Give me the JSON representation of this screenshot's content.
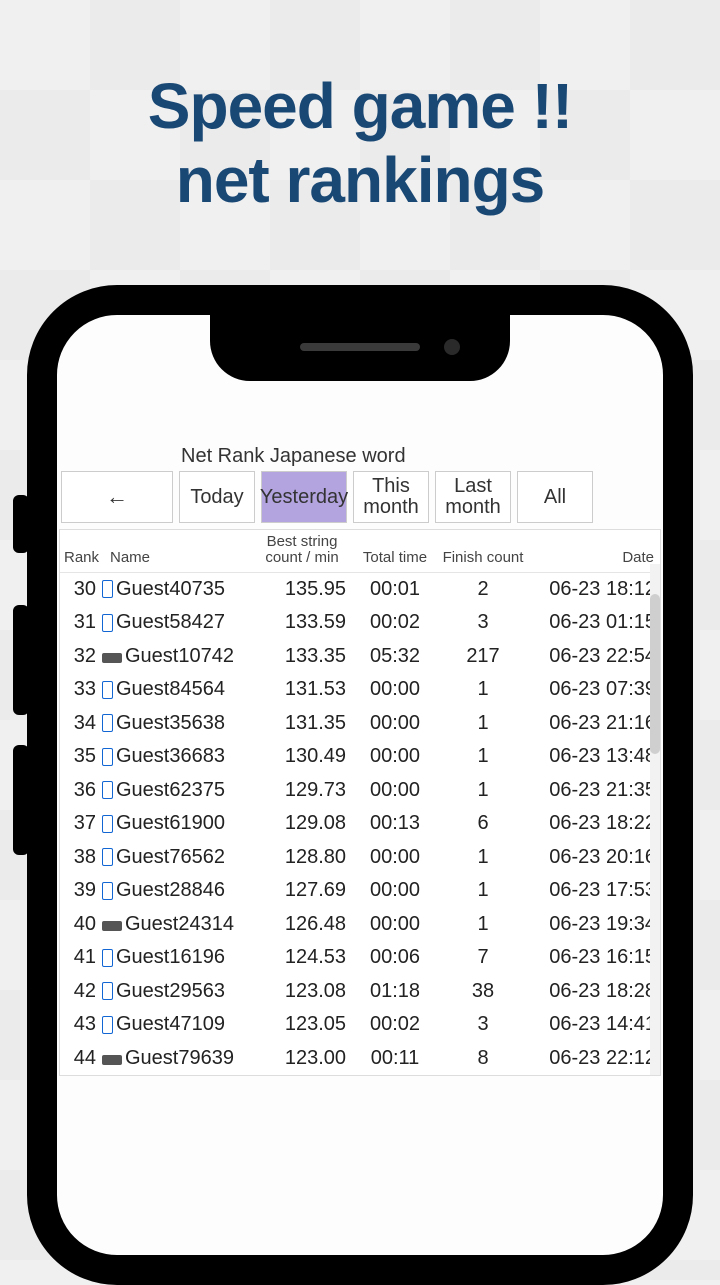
{
  "headline": {
    "line1": "Speed game !!",
    "line2": "net rankings"
  },
  "page_title": "Net Rank Japanese word",
  "back_arrow": "←",
  "tabs": {
    "today": "Today",
    "yesterday": "Yesterday",
    "this_month": "This month",
    "last_month": "Last month",
    "all": "All",
    "active": "yesterday"
  },
  "columns": {
    "rank": "Rank",
    "name": "Name",
    "score": "Best string count / min",
    "time": "Total time",
    "finish": "Finish count",
    "date": "Date"
  },
  "rows": [
    {
      "rank": 30,
      "device": "phone",
      "name": "Guest40735",
      "score": "135.95",
      "time": "00:01",
      "finish": "2",
      "date": "06-23 18:12"
    },
    {
      "rank": 31,
      "device": "phone",
      "name": "Guest58427",
      "score": "133.59",
      "time": "00:02",
      "finish": "3",
      "date": "06-23 01:15"
    },
    {
      "rank": 32,
      "device": "desktop",
      "name": "Guest10742",
      "score": "133.35",
      "time": "05:32",
      "finish": "217",
      "date": "06-23 22:54"
    },
    {
      "rank": 33,
      "device": "phone",
      "name": "Guest84564",
      "score": "131.53",
      "time": "00:00",
      "finish": "1",
      "date": "06-23 07:39"
    },
    {
      "rank": 34,
      "device": "phone",
      "name": "Guest35638",
      "score": "131.35",
      "time": "00:00",
      "finish": "1",
      "date": "06-23 21:16"
    },
    {
      "rank": 35,
      "device": "phone",
      "name": "Guest36683",
      "score": "130.49",
      "time": "00:00",
      "finish": "1",
      "date": "06-23 13:48"
    },
    {
      "rank": 36,
      "device": "phone",
      "name": "Guest62375",
      "score": "129.73",
      "time": "00:00",
      "finish": "1",
      "date": "06-23 21:35"
    },
    {
      "rank": 37,
      "device": "phone",
      "name": "Guest61900",
      "score": "129.08",
      "time": "00:13",
      "finish": "6",
      "date": "06-23 18:22"
    },
    {
      "rank": 38,
      "device": "phone",
      "name": "Guest76562",
      "score": "128.80",
      "time": "00:00",
      "finish": "1",
      "date": "06-23 20:16"
    },
    {
      "rank": 39,
      "device": "phone",
      "name": "Guest28846",
      "score": "127.69",
      "time": "00:00",
      "finish": "1",
      "date": "06-23 17:53"
    },
    {
      "rank": 40,
      "device": "desktop",
      "name": "Guest24314",
      "score": "126.48",
      "time": "00:00",
      "finish": "1",
      "date": "06-23 19:34"
    },
    {
      "rank": 41,
      "device": "phone",
      "name": "Guest16196",
      "score": "124.53",
      "time": "00:06",
      "finish": "7",
      "date": "06-23 16:15"
    },
    {
      "rank": 42,
      "device": "phone",
      "name": "Guest29563",
      "score": "123.08",
      "time": "01:18",
      "finish": "38",
      "date": "06-23 18:28"
    },
    {
      "rank": 43,
      "device": "phone",
      "name": "Guest47109",
      "score": "123.05",
      "time": "00:02",
      "finish": "3",
      "date": "06-23 14:41"
    },
    {
      "rank": 44,
      "device": "desktop",
      "name": "Guest79639",
      "score": "123.00",
      "time": "00:11",
      "finish": "8",
      "date": "06-23 22:12"
    }
  ]
}
